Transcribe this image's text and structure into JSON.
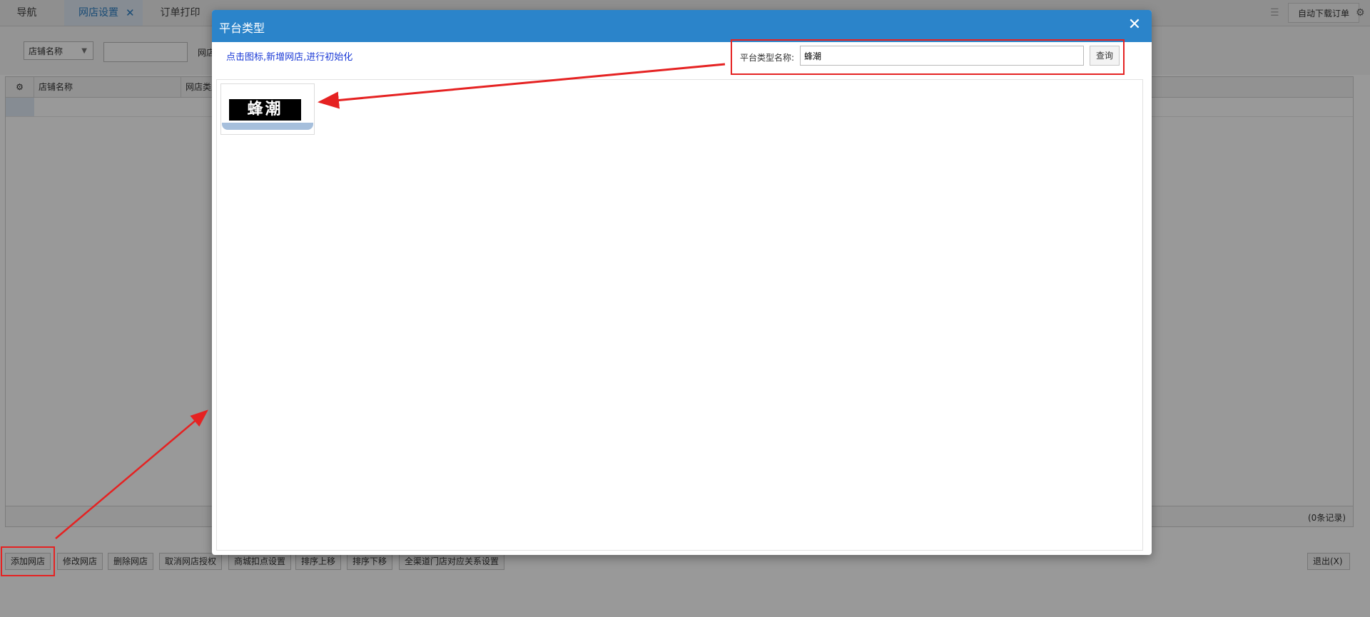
{
  "tabs": [
    {
      "label": "导航",
      "active": false
    },
    {
      "label": "网店设置",
      "active": true,
      "close": "✕"
    },
    {
      "label": "订单打印",
      "active": false
    }
  ],
  "toolbar_right": {
    "auto_download_label": "自动下载订单"
  },
  "filter": {
    "field_select": "店铺名称",
    "field_value": "",
    "second_label": "网店"
  },
  "grid": {
    "columns": [
      "店铺名称",
      "网店类型"
    ],
    "records_text": "(0条记录)"
  },
  "buttons": {
    "add": "添加网店",
    "edit": "修改网店",
    "delete": "删除网店",
    "cancel_auth": "取消网店授权",
    "mall_deduct": "商城扣点设置",
    "sort_up": "排序上移",
    "sort_down": "排序下移",
    "channel_store": "全渠道门店对应关系设置",
    "exit": "退出(X)"
  },
  "modal": {
    "title": "平台类型",
    "close_symbol": "✕",
    "hint": "点击图标,新增网店,进行初始化",
    "search_label": "平台类型名称:",
    "search_value": "蜂潮",
    "search_button": "查询",
    "platforms": [
      {
        "name": "蜂潮",
        "logo_text": "蜂潮"
      }
    ]
  },
  "colors": {
    "header_blue": "#2b84ca",
    "hint_blue": "#1a39d6",
    "highlight_red": "#e52222",
    "active_tab_text": "#2a7dc4"
  }
}
